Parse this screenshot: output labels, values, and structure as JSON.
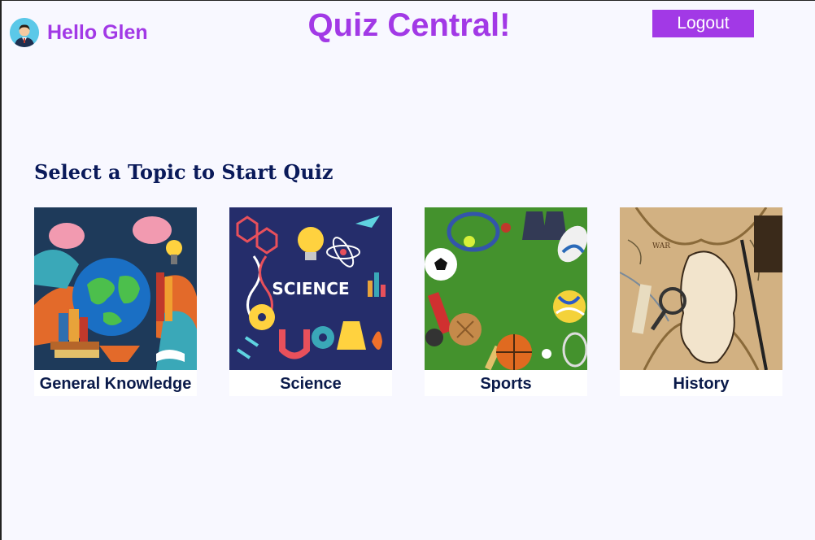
{
  "header": {
    "greeting": "Hello Glen",
    "app_title": "Quiz Central!",
    "logout_label": "Logout"
  },
  "main": {
    "heading": "Select a Topic to Start Quiz",
    "topics": [
      {
        "label": "General Knowledge",
        "icon": "globe-books-image"
      },
      {
        "label": "Science",
        "icon": "science-doodle-image"
      },
      {
        "label": "Sports",
        "icon": "sports-equipment-image"
      },
      {
        "label": "History",
        "icon": "ancient-map-image"
      }
    ]
  },
  "colors": {
    "accent": "#a239e6",
    "heading": "#0a1a5a",
    "background": "#f8f8ff"
  }
}
